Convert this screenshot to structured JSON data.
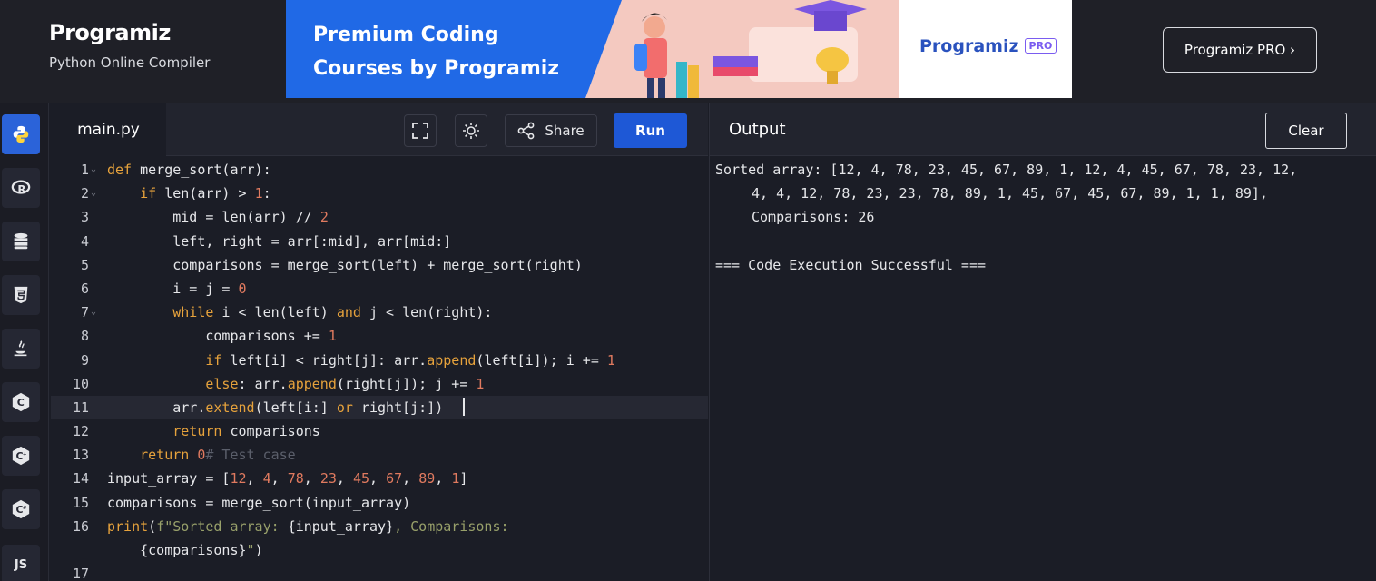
{
  "header": {
    "logo": "Programiz",
    "subtitle": "Python Online Compiler",
    "banner": {
      "line1": "Premium Coding",
      "line2": "Courses by Programiz",
      "brand": "Programiz",
      "badge": "PRO"
    },
    "pro_button": "Programiz PRO ›"
  },
  "sidebar": {
    "items": [
      {
        "icon": "python-icon"
      },
      {
        "icon": "r-lang-icon"
      },
      {
        "icon": "database-icon"
      },
      {
        "icon": "html5-icon"
      },
      {
        "icon": "java-icon"
      },
      {
        "icon": "c-icon"
      },
      {
        "icon": "cpp-icon"
      },
      {
        "icon": "csharp-icon"
      },
      {
        "label": "JS"
      }
    ]
  },
  "editor": {
    "tab": "main.py",
    "share_label": "Share",
    "run_label": "Run",
    "lines": [
      "1",
      "2",
      "3",
      "4",
      "5",
      "6",
      "7",
      "8",
      "9",
      "10",
      "11",
      "12",
      "13",
      "14",
      "15",
      "16",
      "",
      "17"
    ]
  },
  "output": {
    "title": "Output",
    "clear_label": "Clear",
    "lines": [
      "Sorted array: [12, 4, 78, 23, 45, 67, 89, 1, 12, 4, 45, 67, 78, 23, 12,",
      "4, 4, 12, 78, 23, 23, 78, 89, 1, 45, 67, 45, 67, 89, 1, 1, 89],",
      "Comparisons: 26",
      "=== Code Execution Successful ==="
    ]
  },
  "colors": {
    "accent": "#1e58d6",
    "keyword": "#e6a23c",
    "number": "#e07a5f",
    "string": "#98a06a"
  }
}
